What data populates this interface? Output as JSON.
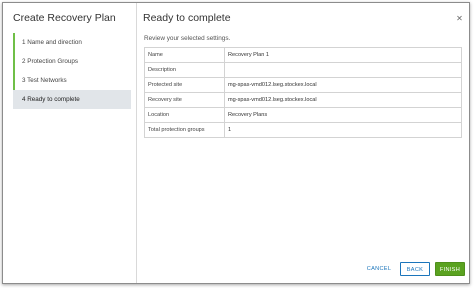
{
  "wizard": {
    "title": "Create Recovery Plan",
    "steps": [
      {
        "label": "1   Name and direction"
      },
      {
        "label": "2   Protection Groups"
      },
      {
        "label": "3   Test Networks"
      },
      {
        "label": "4   Ready to complete"
      }
    ]
  },
  "main": {
    "title": "Ready to complete",
    "subtitle": "Review your selected settings.",
    "rows": [
      {
        "key": "Name",
        "value": "Recovery Plan 1"
      },
      {
        "key": "Description",
        "value": ""
      },
      {
        "key": "Protected site",
        "value": "mg-spas-vmd012.lseg.stockex.local"
      },
      {
        "key": "Recovery site",
        "value": "mg-spas-vmd012.lseg.stockex.local"
      },
      {
        "key": "Location",
        "value": "Recovery Plans"
      },
      {
        "key": "Total protection groups",
        "value": "1"
      }
    ]
  },
  "buttons": {
    "cancel": "CANCEL",
    "back": "BACK",
    "finish": "FINISH"
  },
  "colors": {
    "accent": "#1b75bb",
    "finish": "#5aa220",
    "step_complete": "#6fbf47",
    "active_step_bg": "#e1e5e9"
  }
}
